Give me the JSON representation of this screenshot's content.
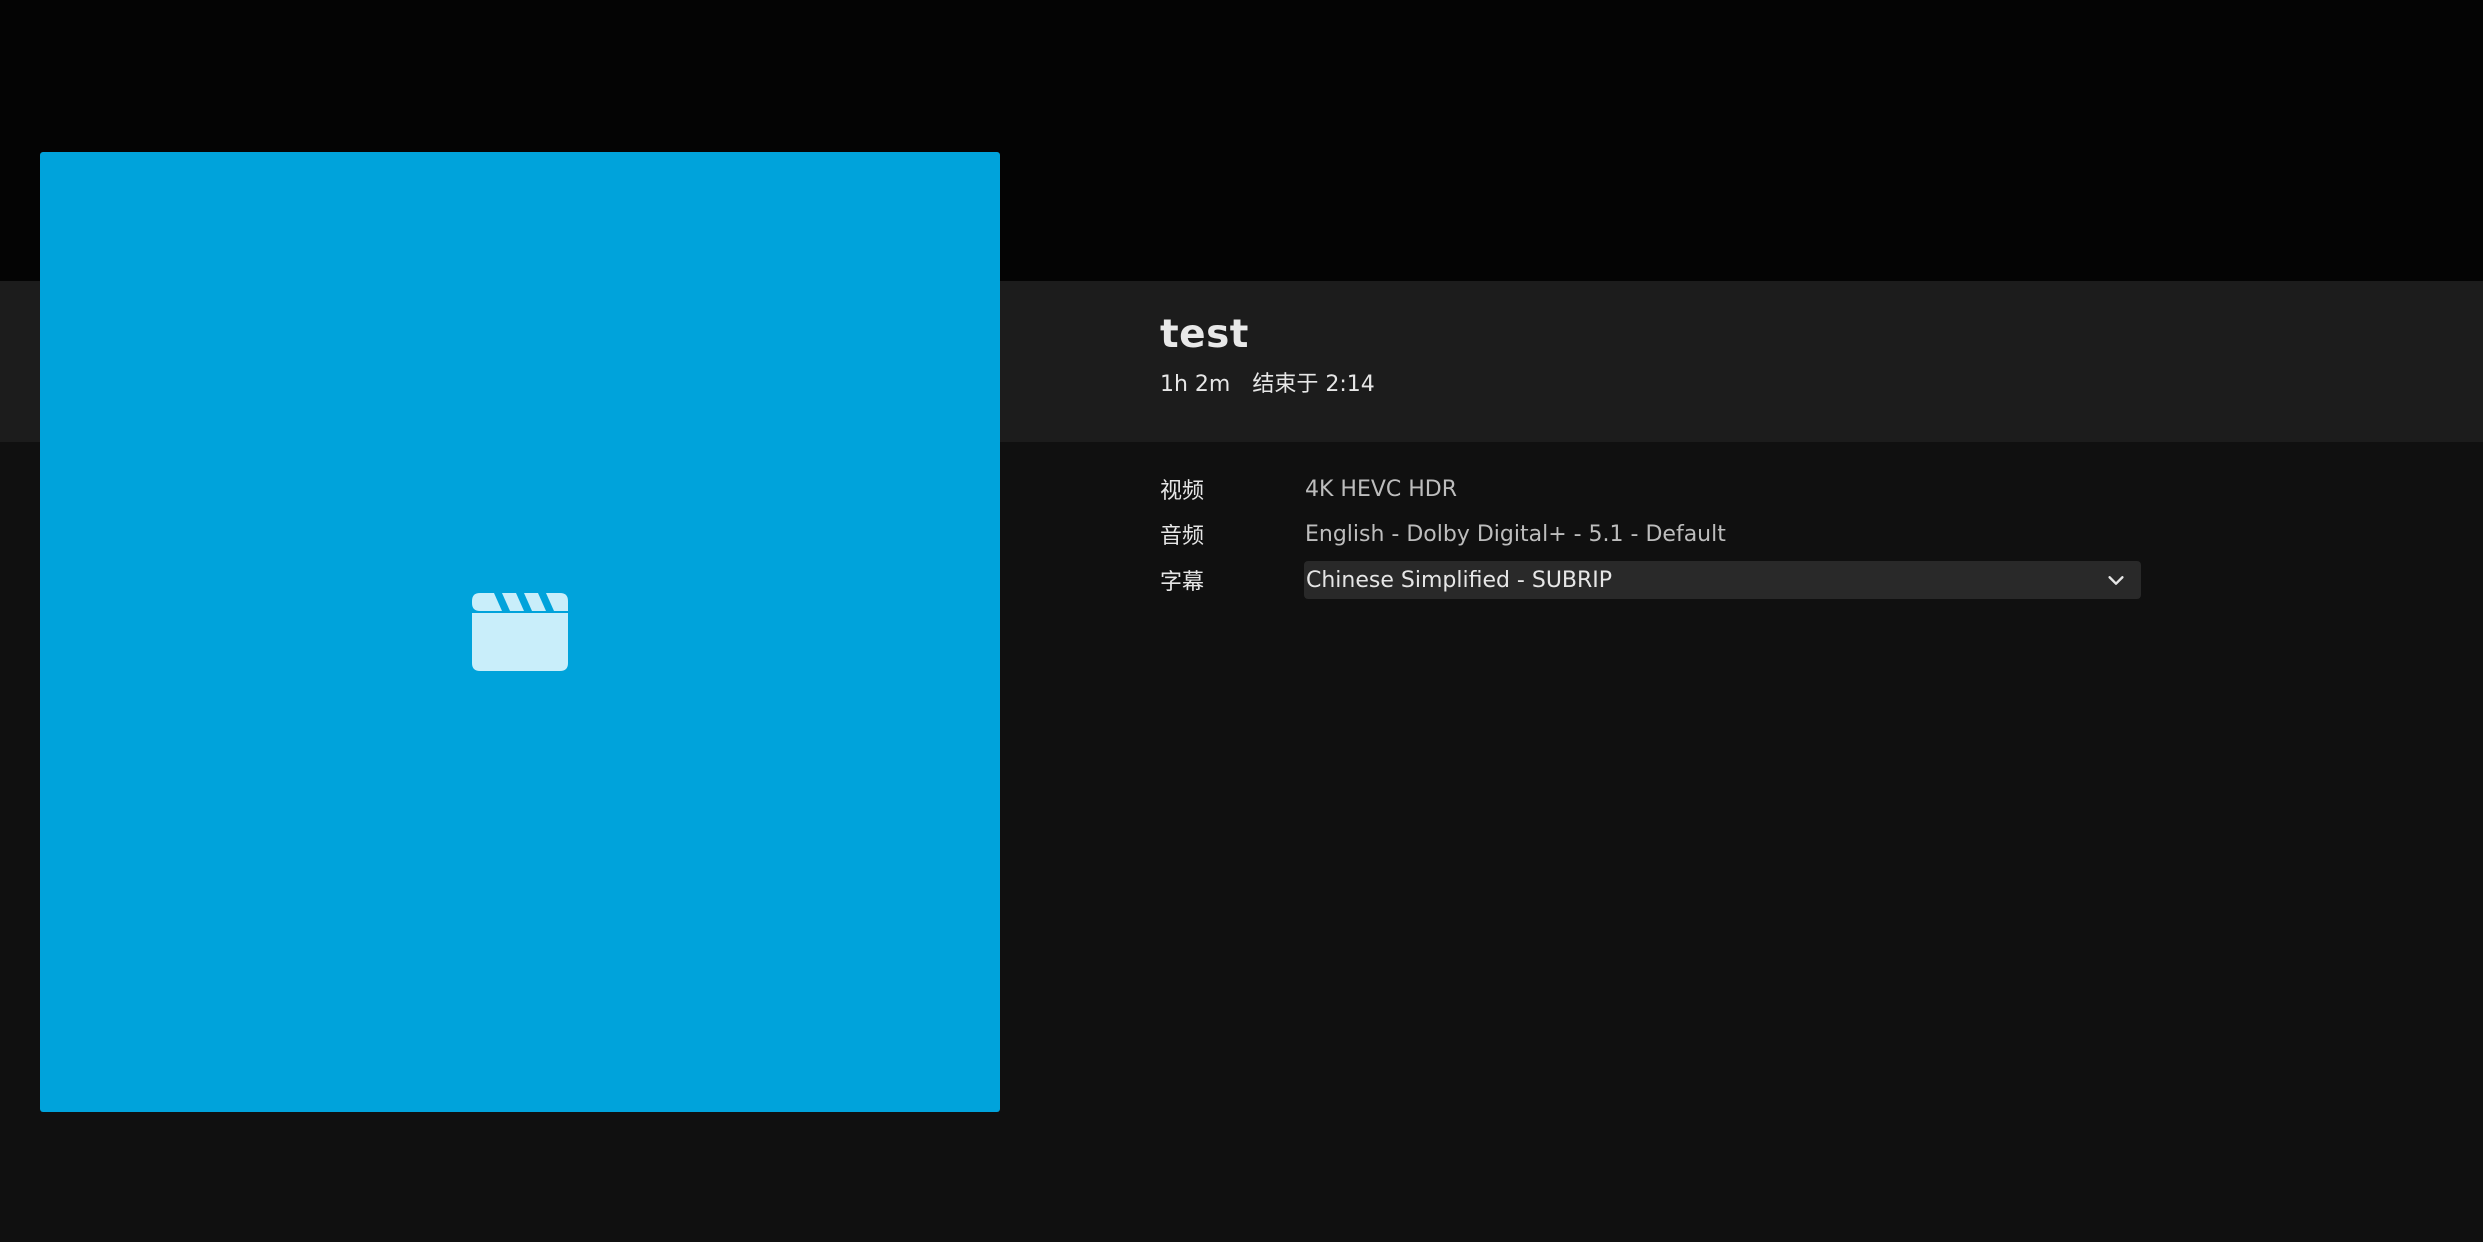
{
  "item": {
    "title": "test",
    "runtime": "1h 2m",
    "ends_at": "结束于 2:14"
  },
  "media_info": {
    "video": {
      "label": "视频",
      "value": "4K HEVC HDR"
    },
    "audio": {
      "label": "音频",
      "value": "English - Dolby Digital+ - 5.1 - Default"
    },
    "subtitle": {
      "label": "字幕",
      "selected": "Chinese Simplified - SUBRIP"
    }
  },
  "poster": {
    "icon": "clapperboard-icon",
    "background_color": "#00a3db"
  }
}
